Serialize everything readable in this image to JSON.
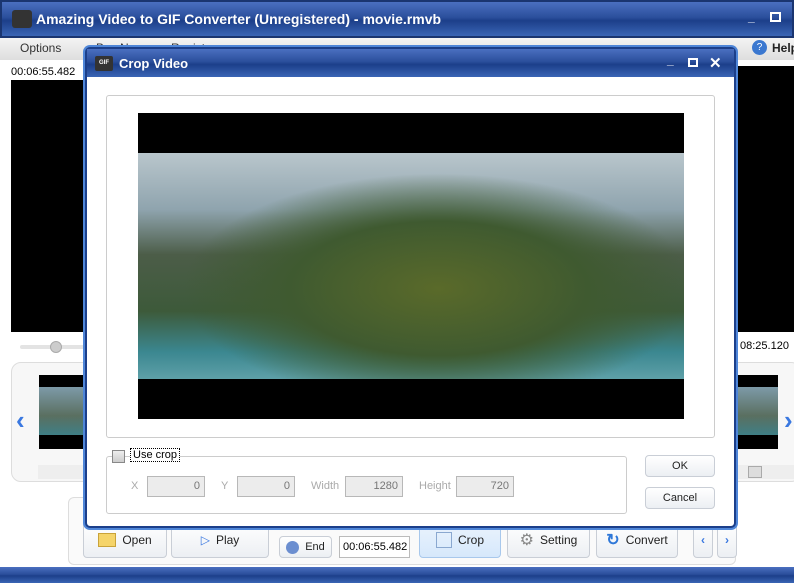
{
  "main": {
    "title": "Amazing Video to GIF Converter (Unregistered) - movie.rmvb",
    "menu": [
      "Options",
      "Buy Now",
      "Register"
    ],
    "help": "Help",
    "start_time": "00:06:55.482",
    "end_time": "08:25.120",
    "toolbar": {
      "open": "Open",
      "play": "Play",
      "end": "End",
      "end_time": "00:06:55.482",
      "crop": "Crop",
      "setting": "Setting",
      "convert": "Convert"
    }
  },
  "dialog": {
    "title": "Crop Video",
    "use_crop": "Use crop",
    "use_crop_checked": false,
    "x_label": "X",
    "x": "0",
    "y_label": "Y",
    "y": "0",
    "width_label": "Width",
    "width": "1280",
    "height_label": "Height",
    "height": "720",
    "ok": "OK",
    "cancel": "Cancel"
  }
}
